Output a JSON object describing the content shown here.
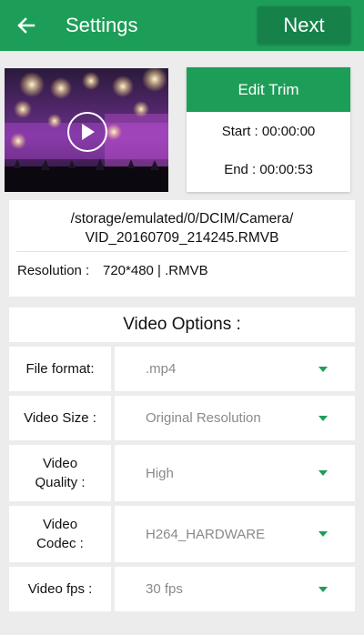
{
  "appbar": {
    "title": "Settings",
    "next_label": "Next"
  },
  "video": {
    "thumbnail": "concert-stage-lights",
    "play_icon": "play-icon"
  },
  "trim": {
    "edit_label": "Edit Trim",
    "start": "Start : 00:00:00",
    "end": "End : 00:00:53"
  },
  "file": {
    "path_line1": "/storage/emulated/0/DCIM/Camera/",
    "path_line2": "VID_20160709_214245.RMVB",
    "resolution_label": "Resolution :",
    "resolution_value": "720*480 | .RMVB"
  },
  "options": {
    "header": "Video Options :",
    "items": [
      {
        "label": "File format:",
        "value": ".mp4"
      },
      {
        "label": "Video Size :",
        "value": "Original Resolution"
      },
      {
        "label": "Video Quality :",
        "value": "High"
      },
      {
        "label": "Video Codec :",
        "value": "H264_HARDWARE"
      },
      {
        "label": "Video fps :",
        "value": "30 fps"
      }
    ]
  },
  "colors": {
    "primary": "#1d9e58",
    "primary_dark": "#16824a",
    "background": "#ececec"
  }
}
